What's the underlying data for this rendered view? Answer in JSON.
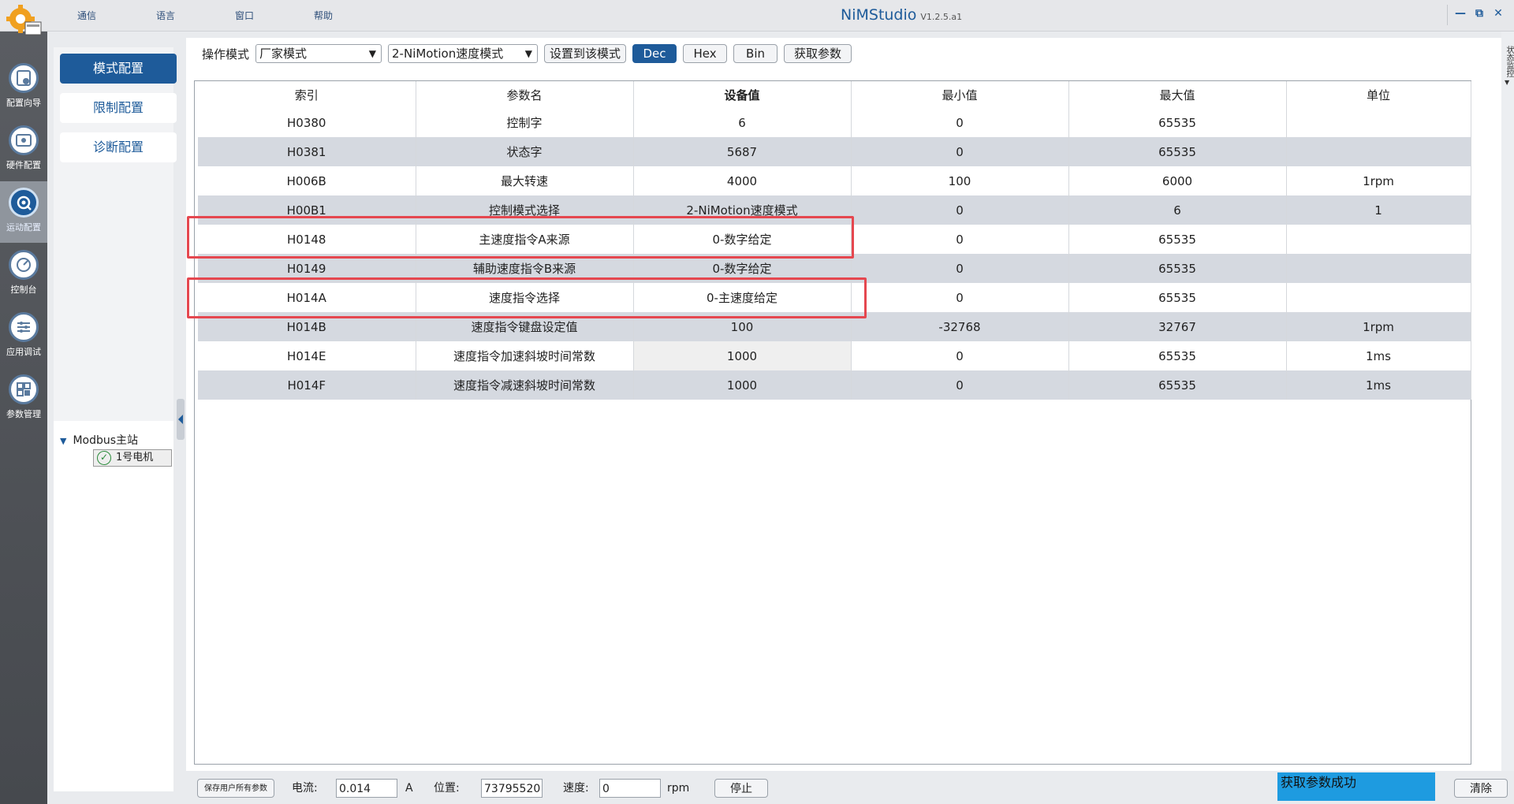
{
  "app": {
    "title": "NiMStudio",
    "version": "V1.2.5.a1"
  },
  "menu": [
    "通信",
    "语言",
    "窗口",
    "帮助"
  ],
  "window_controls": [
    "—",
    "⧉",
    "✕"
  ],
  "rail": [
    {
      "label": "配置向导",
      "icon": "config-wizard-icon"
    },
    {
      "label": "硬件配置",
      "icon": "hardware-config-icon"
    },
    {
      "label": "运动配置",
      "icon": "motion-config-icon",
      "active": true
    },
    {
      "label": "控制台",
      "icon": "console-gauge-icon"
    },
    {
      "label": "应用调试",
      "icon": "app-debug-icon"
    },
    {
      "label": "参数管理",
      "icon": "param-manage-icon"
    }
  ],
  "config_buttons": [
    "模式配置",
    "限制配置",
    "诊断配置"
  ],
  "tree": {
    "root": "Modbus主站",
    "child": "1号电机"
  },
  "toolbar": {
    "mode_label": "操作模式",
    "mode_value": "厂家模式",
    "motion_value": "2-NiMotion速度模式",
    "set_mode_button": "设置到该模式",
    "dec": "Dec",
    "hex": "Hex",
    "bin": "Bin",
    "fetch_button": "获取参数"
  },
  "table": {
    "headers": [
      "索引",
      "参数名",
      "设备值",
      "最小值",
      "最大值",
      "单位"
    ],
    "rows": [
      [
        "H0380",
        "控制字",
        "6",
        "0",
        "65535",
        ""
      ],
      [
        "H0381",
        "状态字",
        "5687",
        "0",
        "65535",
        ""
      ],
      [
        "H006B",
        "最大转速",
        "4000",
        "100",
        "6000",
        "1rpm"
      ],
      [
        "H00B1",
        "控制模式选择",
        "2-NiMotion速度模式",
        "0",
        "6",
        "1"
      ],
      [
        "H0148",
        "主速度指令A来源",
        "0-数字给定",
        "0",
        "65535",
        ""
      ],
      [
        "H0149",
        "辅助速度指令B来源",
        "0-数字给定",
        "0",
        "65535",
        ""
      ],
      [
        "H014A",
        "速度指令选择",
        "0-主速度给定",
        "0",
        "65535",
        ""
      ],
      [
        "H014B",
        "速度指令键盘设定值",
        "100",
        "-32768",
        "32767",
        "1rpm"
      ],
      [
        "H014E",
        "速度指令加速斜坡时间常数",
        "1000",
        "0",
        "65535",
        "1ms"
      ],
      [
        "H014F",
        "速度指令减速斜坡时间常数",
        "1000",
        "0",
        "65535",
        "1ms"
      ]
    ]
  },
  "side_strip": "状态监控",
  "bottom": {
    "save_button": "保存用户所有参数",
    "current_label": "电流:",
    "current_value": "0.014",
    "current_unit": "A",
    "position_label": "位置:",
    "position_value": "73795520",
    "speed_label": "速度:",
    "speed_value": "0",
    "speed_unit": "rpm",
    "stop_button": "停止",
    "status_message": "获取参数成功",
    "clear_button": "清除"
  },
  "colors": {
    "accent": "#1e5b9a",
    "highlight_box": "#e5474f",
    "row_alt": "#d5d9e0",
    "status_bg": "#1e9be0"
  }
}
